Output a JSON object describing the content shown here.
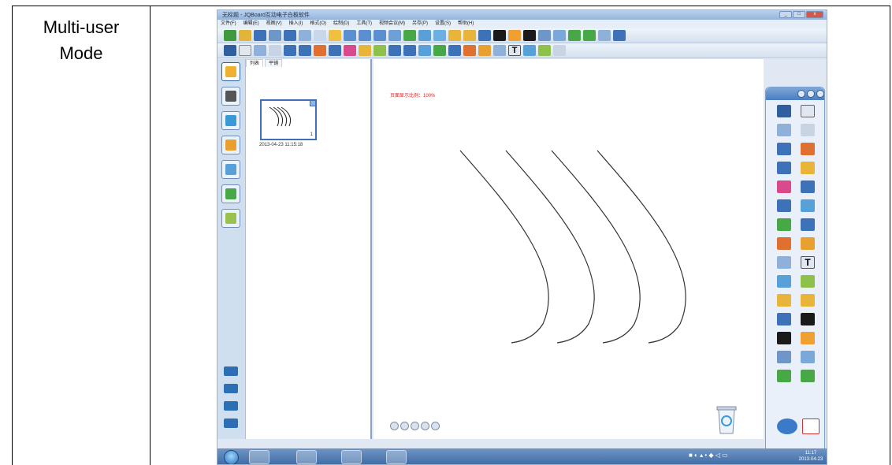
{
  "table": {
    "label": "Multi-user Mode",
    "label_line1": "Multi-user",
    "label_line2": "Mode"
  },
  "window": {
    "title": "无标题 - JQBoard互动电子白板软件",
    "controls": [
      "minimize-button",
      "maximize-button",
      "close-button"
    ]
  },
  "menu": {
    "items": [
      "文件(F)",
      "编辑(E)",
      "视图(V)",
      "插入(I)",
      "格式(O)",
      "绘制(D)",
      "工具(T)",
      "视频会议(M)",
      "另存(P)",
      "设置(S)",
      "帮助(H)"
    ]
  },
  "page_panel": {
    "tabs": [
      "列表",
      "平铺"
    ],
    "thumbnail_page": "1",
    "thumbnail_date": "2013-04-23 11:15:18"
  },
  "canvas": {
    "page_info": "页面显示比例：100%"
  },
  "taskbar": {
    "clock_time": "11:17",
    "clock_date": "2013-04-23"
  },
  "colors": {
    "page_info_text": "#dd2222",
    "titlebar": "#93b3da",
    "palette_header": "#4a7ec0",
    "taskbar": "#3d6aa3"
  }
}
